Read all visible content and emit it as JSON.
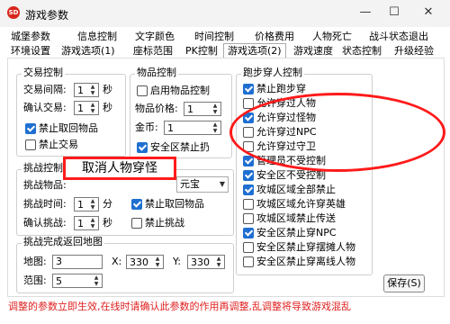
{
  "window": {
    "title": "游戏参数",
    "app_icon": "app-logo-icon",
    "minimize": "—",
    "maximize": "☐",
    "close": "✕"
  },
  "tabs": {
    "row1": [
      "城堡参数",
      "信息控制",
      "文字颜色",
      "时间控制",
      "价格费用",
      "人物死亡",
      "战斗状态退出"
    ],
    "row2": [
      "环境设置",
      "游戏选项(1)",
      "座标范围",
      "PK控制",
      "游戏选项(2)",
      "游戏速度",
      "状态控制",
      "升级经验"
    ],
    "active": "游戏选项(2)"
  },
  "trade": {
    "title": "交易控制",
    "interval_label": "交易间隔:",
    "interval_value": "1",
    "interval_unit": "秒",
    "confirm_label": "确认交易:",
    "confirm_value": "1",
    "confirm_unit": "秒",
    "no_pickup_label": "禁止取回物品",
    "no_pickup_checked": true,
    "no_trade_label": "禁止交易",
    "no_trade_checked": false
  },
  "items": {
    "title": "物品控制",
    "enable_label": "启用物品控制",
    "enable_checked": false,
    "price_label": "物品价格:",
    "price_value": "1",
    "gold_label": "金币:",
    "gold_value": "1",
    "safe_zone_label": "安全区禁止扔",
    "safe_zone_checked": true
  },
  "challenge": {
    "title": "挑战控制",
    "item_label": "挑战物品:",
    "time_label": "挑战时间:",
    "time_value": "1",
    "time_unit": "分",
    "confirm_label": "确认挑战:",
    "confirm_value": "1",
    "confirm_unit": "秒",
    "combo_value": "元宝",
    "no_pickup_label": "禁止取回物品",
    "no_pickup_checked": true,
    "no_challenge_label": "禁止挑战",
    "no_challenge_checked": false
  },
  "return_map": {
    "title": "挑战完成返回地图",
    "map_label": "地图:",
    "map_value": "3",
    "x_label": "X:",
    "x_value": "330",
    "y_label": "Y:",
    "y_value": "330",
    "range_label": "范围:",
    "range_value": "5"
  },
  "run": {
    "title": "跑步穿人控制",
    "items": [
      {
        "label": "禁止跑步穿",
        "checked": true
      },
      {
        "label": "允许穿过人物",
        "checked": false
      },
      {
        "label": "允许穿过怪物",
        "checked": true
      },
      {
        "label": "允许穿过NPC",
        "checked": false
      },
      {
        "label": "允许穿过守卫",
        "checked": false
      },
      {
        "label": "管理员不受控制",
        "checked": true
      },
      {
        "label": "安全区不受控制",
        "checked": true
      },
      {
        "label": "攻城区域全部禁止",
        "checked": true
      },
      {
        "label": "攻城区域允许穿英雄",
        "checked": false
      },
      {
        "label": "攻城区域禁止传送",
        "checked": false
      },
      {
        "label": "安全区禁止穿NPC",
        "checked": true
      },
      {
        "label": "安全区禁止穿摆摊人物",
        "checked": false
      },
      {
        "label": "安全区禁止穿离线人物",
        "checked": false
      }
    ]
  },
  "annotation": {
    "callout": "取消人物穿怪"
  },
  "save_label": "保存(S)",
  "status_text": "调整的参数立即生效,在线时请确认此参数的作用再调整,乱调整将导致游戏混乱"
}
